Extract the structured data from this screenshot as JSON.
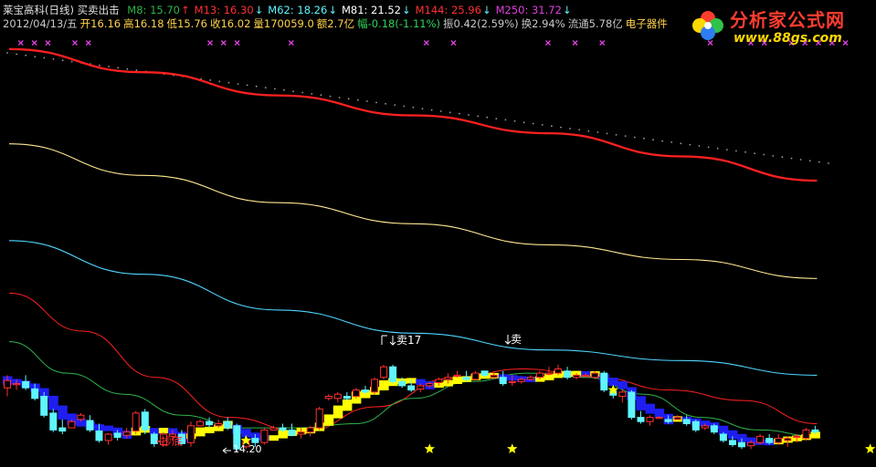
{
  "header": {
    "title": "莱宝高科(日线) 买卖出击",
    "ma": [
      {
        "label": "M8: 15.70",
        "arrow": "↑",
        "color": "#2fb24a",
        "arrow_color": "#ff3030"
      },
      {
        "label": "M13: 16.30",
        "arrow": "↓",
        "color": "#ff3030",
        "arrow_color": "#5ff5ff"
      },
      {
        "label": "M62: 18.26",
        "arrow": "↓",
        "color": "#5ff5ff",
        "arrow_color": "#5ff5ff"
      },
      {
        "label": "M81: 21.52",
        "arrow": "↓",
        "color": "#ffffff",
        "arrow_color": "#5ff5ff"
      },
      {
        "label": "M144: 25.96",
        "arrow": "↓",
        "color": "#ff3030",
        "arrow_color": "#5ff5ff"
      },
      {
        "label": "M250: 31.72",
        "arrow": "↓",
        "color": "#e040e0",
        "arrow_color": "#5ff5ff"
      }
    ],
    "info": [
      {
        "text": "2012/04/13/五",
        "color": "#c8c8c8"
      },
      {
        "text": "开16.16",
        "color": "#ffd24a"
      },
      {
        "text": "高16.18",
        "color": "#ffd24a"
      },
      {
        "text": "低15.76",
        "color": "#ffd24a"
      },
      {
        "text": "收16.02",
        "color": "#ffd24a"
      },
      {
        "text": "量170059.0",
        "color": "#ffd24a"
      },
      {
        "text": "额2.7亿",
        "color": "#ffd24a"
      },
      {
        "text": "幅-0.18(-1.11%)",
        "color": "#2fd35a"
      },
      {
        "text": "振0.42(2.59%)",
        "color": "#c8c8c8"
      },
      {
        "text": "换2.94%",
        "color": "#c8c8c8"
      },
      {
        "text": "流通5.78亿",
        "color": "#c8c8c8"
      },
      {
        "text": "电子器件",
        "color": "#ffd24a"
      }
    ]
  },
  "logo": {
    "title": "分析家公式网",
    "url": "www.88gs.com"
  },
  "annotations": {
    "buy": "抄底",
    "low": "14.20",
    "sell1": "卖17",
    "sell2": "卖"
  },
  "chart_data": {
    "type": "candlestick",
    "title": "莱宝高科(日线) 买卖出击",
    "ylim": [
      13.6,
      33.8
    ],
    "up_color": "#ff3030",
    "down_color": "#5ff5ff",
    "candles": [
      [
        17.1,
        17.7,
        16.7,
        17.45
      ],
      [
        17.3,
        17.5,
        17.0,
        17.3
      ],
      [
        17.4,
        17.7,
        17.0,
        17.1
      ],
      [
        17.05,
        17.3,
        16.5,
        16.6
      ],
      [
        16.7,
        16.9,
        15.7,
        15.8
      ],
      [
        15.9,
        16.1,
        15.0,
        15.1
      ],
      [
        15.2,
        15.6,
        14.9,
        15.05
      ],
      [
        15.2,
        15.6,
        15.2,
        15.5
      ],
      [
        15.6,
        15.9,
        15.5,
        15.8
      ],
      [
        15.55,
        15.8,
        15.0,
        15.1
      ],
      [
        15.05,
        15.4,
        14.5,
        14.6
      ],
      [
        14.6,
        14.95,
        14.4,
        14.9
      ],
      [
        14.95,
        15.1,
        14.6,
        14.75
      ],
      [
        14.85,
        15.2,
        14.7,
        15.0
      ],
      [
        15.05,
        16.0,
        14.9,
        15.9
      ],
      [
        15.95,
        16.1,
        14.9,
        15.1
      ],
      [
        14.9,
        15.0,
        14.3,
        14.45
      ],
      [
        14.4,
        15.0,
        14.3,
        14.9
      ],
      [
        14.8,
        15.1,
        14.6,
        14.9
      ],
      [
        14.9,
        15.1,
        14.35,
        14.45
      ],
      [
        14.5,
        15.5,
        14.3,
        15.3
      ],
      [
        15.3,
        15.6,
        15.3,
        15.5
      ],
      [
        15.5,
        15.7,
        15.2,
        15.35
      ],
      [
        15.3,
        15.6,
        15.2,
        15.4
      ],
      [
        15.5,
        15.7,
        15.1,
        15.2
      ],
      [
        15.3,
        15.4,
        14.1,
        14.2
      ],
      [
        14.3,
        14.7,
        14.2,
        14.6
      ],
      [
        14.7,
        14.9,
        14.3,
        14.5
      ],
      [
        14.5,
        15.2,
        14.4,
        15.1
      ],
      [
        15.1,
        15.3,
        15.1,
        15.2
      ],
      [
        15.2,
        15.4,
        15.0,
        15.1
      ],
      [
        15.1,
        15.4,
        14.8,
        14.85
      ],
      [
        14.9,
        15.2,
        14.7,
        15.0
      ],
      [
        15.0,
        15.3,
        14.8,
        15.2
      ],
      [
        15.2,
        16.2,
        15.1,
        16.1
      ],
      [
        16.6,
        16.8,
        16.5,
        16.7
      ],
      [
        16.6,
        16.9,
        16.4,
        16.8
      ],
      [
        16.7,
        16.9,
        16.5,
        16.6
      ],
      [
        16.7,
        17.1,
        16.6,
        17.0
      ],
      [
        17.0,
        17.2,
        16.8,
        16.9
      ],
      [
        16.9,
        17.6,
        16.8,
        17.5
      ],
      [
        17.6,
        18.2,
        17.5,
        18.1
      ],
      [
        18.1,
        18.2,
        17.3,
        17.4
      ],
      [
        17.4,
        17.6,
        17.1,
        17.2
      ],
      [
        17.2,
        17.5,
        16.9,
        17.0
      ],
      [
        17.05,
        17.3,
        16.9,
        17.2
      ],
      [
        17.2,
        17.4,
        17.1,
        17.3
      ],
      [
        17.35,
        17.6,
        17.2,
        17.5
      ],
      [
        17.5,
        17.8,
        17.3,
        17.6
      ],
      [
        17.7,
        17.9,
        17.6,
        17.7
      ],
      [
        17.6,
        17.9,
        17.4,
        17.5
      ],
      [
        17.5,
        17.9,
        17.5,
        17.8
      ],
      [
        17.9,
        17.9,
        17.6,
        17.7
      ],
      [
        17.6,
        17.85,
        17.5,
        17.7
      ],
      [
        17.6,
        17.9,
        17.2,
        17.3
      ],
      [
        17.35,
        17.7,
        17.2,
        17.4
      ],
      [
        17.4,
        17.6,
        17.3,
        17.5
      ],
      [
        17.5,
        17.7,
        17.45,
        17.6
      ],
      [
        17.6,
        17.9,
        17.5,
        17.8
      ],
      [
        17.75,
        18.1,
        17.7,
        17.8
      ],
      [
        17.8,
        18.2,
        17.7,
        18.0
      ],
      [
        17.9,
        18.1,
        17.5,
        17.6
      ],
      [
        17.6,
        17.8,
        17.5,
        17.7
      ],
      [
        17.7,
        17.8,
        17.6,
        17.7
      ],
      [
        17.6,
        17.9,
        17.5,
        17.8
      ],
      [
        17.8,
        17.9,
        16.9,
        17.0
      ],
      [
        16.95,
        17.1,
        16.6,
        16.75
      ],
      [
        16.7,
        17.0,
        16.4,
        16.9
      ],
      [
        16.9,
        17.0,
        15.6,
        15.7
      ],
      [
        15.7,
        16.0,
        15.4,
        15.5
      ],
      [
        15.5,
        15.8,
        15.3,
        15.7
      ],
      [
        15.7,
        15.75,
        15.65,
        15.7
      ],
      [
        15.6,
        15.8,
        15.4,
        15.5
      ],
      [
        15.6,
        15.8,
        15.6,
        15.7
      ],
      [
        15.6,
        15.8,
        15.3,
        15.4
      ],
      [
        15.5,
        15.6,
        15.0,
        15.1
      ],
      [
        15.2,
        15.4,
        15.1,
        15.3
      ],
      [
        15.3,
        15.4,
        14.9,
        15.0
      ],
      [
        14.9,
        15.0,
        14.5,
        14.6
      ],
      [
        14.6,
        14.8,
        14.3,
        14.4
      ],
      [
        14.5,
        14.7,
        14.2,
        14.3
      ],
      [
        14.35,
        14.6,
        14.2,
        14.5
      ],
      [
        14.5,
        14.9,
        14.4,
        14.8
      ],
      [
        14.7,
        14.9,
        14.4,
        14.5
      ],
      [
        14.5,
        14.9,
        14.4,
        14.7
      ],
      [
        14.6,
        14.8,
        14.3,
        14.7
      ],
      [
        14.75,
        14.9,
        14.5,
        14.8
      ],
      [
        14.7,
        15.2,
        14.6,
        15.1
      ],
      [
        15.1,
        15.3,
        14.9,
        15.0
      ]
    ],
    "series": [
      {
        "color": "#ff2020",
        "width": 2.3,
        "values": [
          33.2,
          32.1,
          31.0,
          30.05,
          29.2,
          28.1,
          26.95
        ]
      },
      {
        "color": "#ffe890",
        "width": 1.1,
        "values": [
          28.7,
          27.2,
          25.9,
          24.9,
          23.9,
          23.2,
          22.3
        ]
      },
      {
        "color": "#4fd6ff",
        "width": 1.1,
        "values": [
          24.1,
          22.5,
          20.8,
          19.7,
          18.9,
          18.4,
          17.7
        ]
      },
      {
        "color": "#ff2020",
        "width": 1.0,
        "values": [
          21.6,
          19.8,
          17.6,
          15.7,
          15.0,
          16.2,
          17.55,
          18.0,
          17.6,
          17.0,
          16.5,
          15.4
        ]
      },
      {
        "color": "#2fb24a",
        "width": 1.0,
        "values": [
          19.3,
          17.8,
          16.8,
          15.8,
          15.2,
          15.2,
          15.4,
          16.6,
          17.4,
          17.8,
          17.6,
          16.8,
          15.7,
          15.1,
          14.8
        ]
      }
    ],
    "stars": [
      [
        26,
        14.6
      ],
      [
        46,
        14.2
      ],
      [
        55,
        14.2
      ],
      [
        66,
        17.0
      ],
      [
        94,
        14.2
      ]
    ],
    "x_markers": [
      1,
      2,
      3,
      5,
      6,
      15,
      16,
      17,
      21,
      31,
      33,
      40,
      42,
      44,
      52,
      55,
      56,
      58,
      59,
      60,
      61,
      62
    ]
  }
}
